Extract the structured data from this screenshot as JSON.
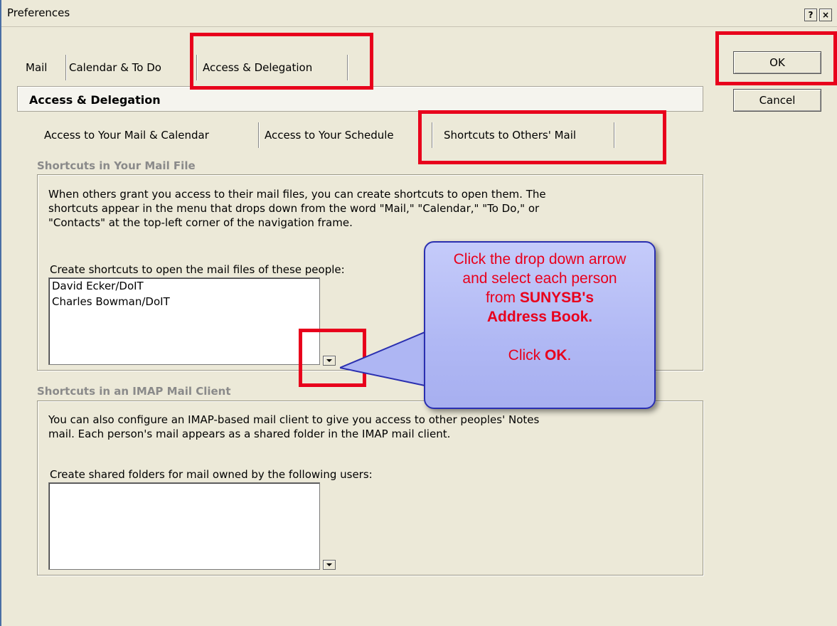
{
  "window": {
    "title": "Preferences",
    "help_btn": "?",
    "close_btn": "×"
  },
  "main_tabs": [
    {
      "label": "Mail"
    },
    {
      "label": "Calendar & To Do"
    },
    {
      "label": "Access & Delegation"
    }
  ],
  "buttons": {
    "ok": "OK",
    "cancel": "Cancel"
  },
  "section_title": "Access & Delegation",
  "sub_tabs": [
    {
      "label": "Access to Your Mail & Calendar"
    },
    {
      "label": "Access to Your Schedule"
    },
    {
      "label": "Shortcuts to Others' Mail"
    }
  ],
  "group1": {
    "label": "Shortcuts in Your Mail File",
    "para_lines": [
      "When others grant you access to their mail files, you can create shortcuts to open them. The",
      "shortcuts appear in the menu that drops down from the word \"Mail,\" \"Calendar,\" \"To Do,\" or",
      "\"Contacts\" at the top-left corner of the navigation frame."
    ],
    "field_label": "Create shortcuts to open the mail files of these people:",
    "items": [
      "David Ecker/DoIT",
      "Charles Bowman/DoIT"
    ]
  },
  "group2": {
    "label": "Shortcuts in an IMAP Mail Client",
    "para_lines": [
      "You can also configure an IMAP-based mail client to give you access to other peoples' Notes",
      "mail. Each person's mail appears as a shared folder in the IMAP mail client."
    ],
    "field_label": "Create shared folders for mail owned by the following users:",
    "items": []
  },
  "callout": {
    "line1": "Click the drop down arrow",
    "line2": "and select each person",
    "line3_pre": "from ",
    "line3_bold": "SUNYSB's",
    "line4_bold": "Address Book.",
    "line5_pre": "Click ",
    "line5_bold": "OK",
    "line5_post": "."
  },
  "colors": {
    "highlight_red": "#e8001c",
    "callout_border": "#2a2fb0",
    "callout_fill": "#b0b8f4",
    "dialog_bg": "#ece9d8"
  }
}
